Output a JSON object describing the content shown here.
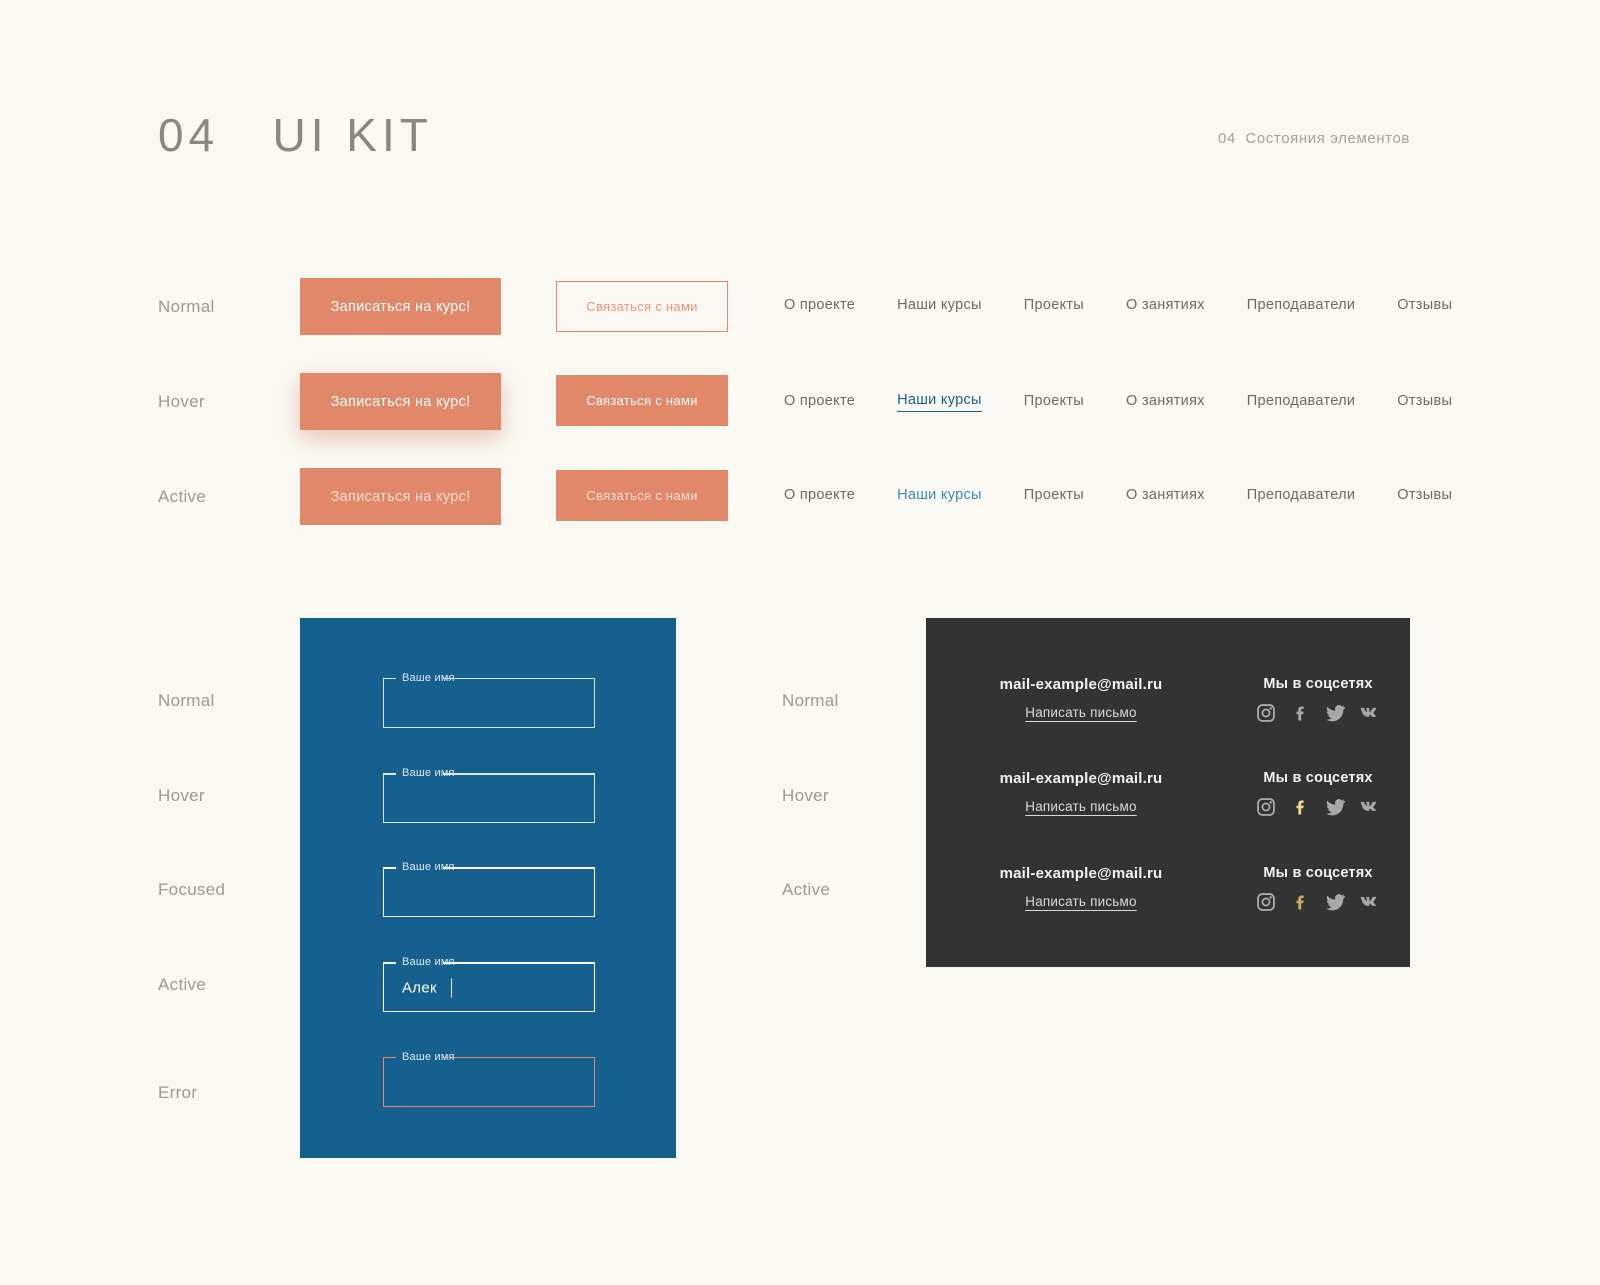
{
  "header": {
    "title": "04   UI KIT",
    "right_label": "04  Состояния элементов"
  },
  "states": {
    "normal": "Normal",
    "hover": "Hover",
    "active": "Active",
    "focused": "Focused",
    "error": "Error"
  },
  "buttons": {
    "primary_label": "Записаться на курс!",
    "secondary_label": "Связаться с нами",
    "primary_color": "#e2886a",
    "secondary_border_color": "#e2886a"
  },
  "nav": {
    "items": [
      "О проекте",
      "Наши курсы",
      "Проекты",
      "О занятиях",
      "Преподаватели",
      "Отзывы"
    ],
    "hover_index": 1,
    "active_index": 1,
    "hover_color": "#1c5e91",
    "active_color": "#3f87bd",
    "normal_color": "#6d6a64"
  },
  "form": {
    "panel_color": "#15608f",
    "label": "Ваше имя",
    "rows": [
      {
        "state": "Normal",
        "value": ""
      },
      {
        "state": "Hover",
        "value": ""
      },
      {
        "state": "Focused",
        "value": ""
      },
      {
        "state": "Active",
        "value": "Алек"
      },
      {
        "state": "Error",
        "value": ""
      }
    ],
    "error_color": "#e2886a"
  },
  "footer": {
    "panel_color": "#333333",
    "email": "mail-example@mail.ru",
    "write_link": "Написать письмо",
    "social_title": "Мы в соцсетях",
    "icons": [
      "instagram-icon",
      "facebook-icon",
      "twitter-icon",
      "vk-icon"
    ],
    "rows": [
      {
        "state": "Normal",
        "highlight_icon": -1
      },
      {
        "state": "Hover",
        "highlight_icon": 1
      },
      {
        "state": "Active",
        "highlight_icon": 1
      }
    ],
    "icon_color": "#a8a8a8",
    "highlight_color": "#f0d48a",
    "highlight_active_color": "#c9ab63"
  }
}
